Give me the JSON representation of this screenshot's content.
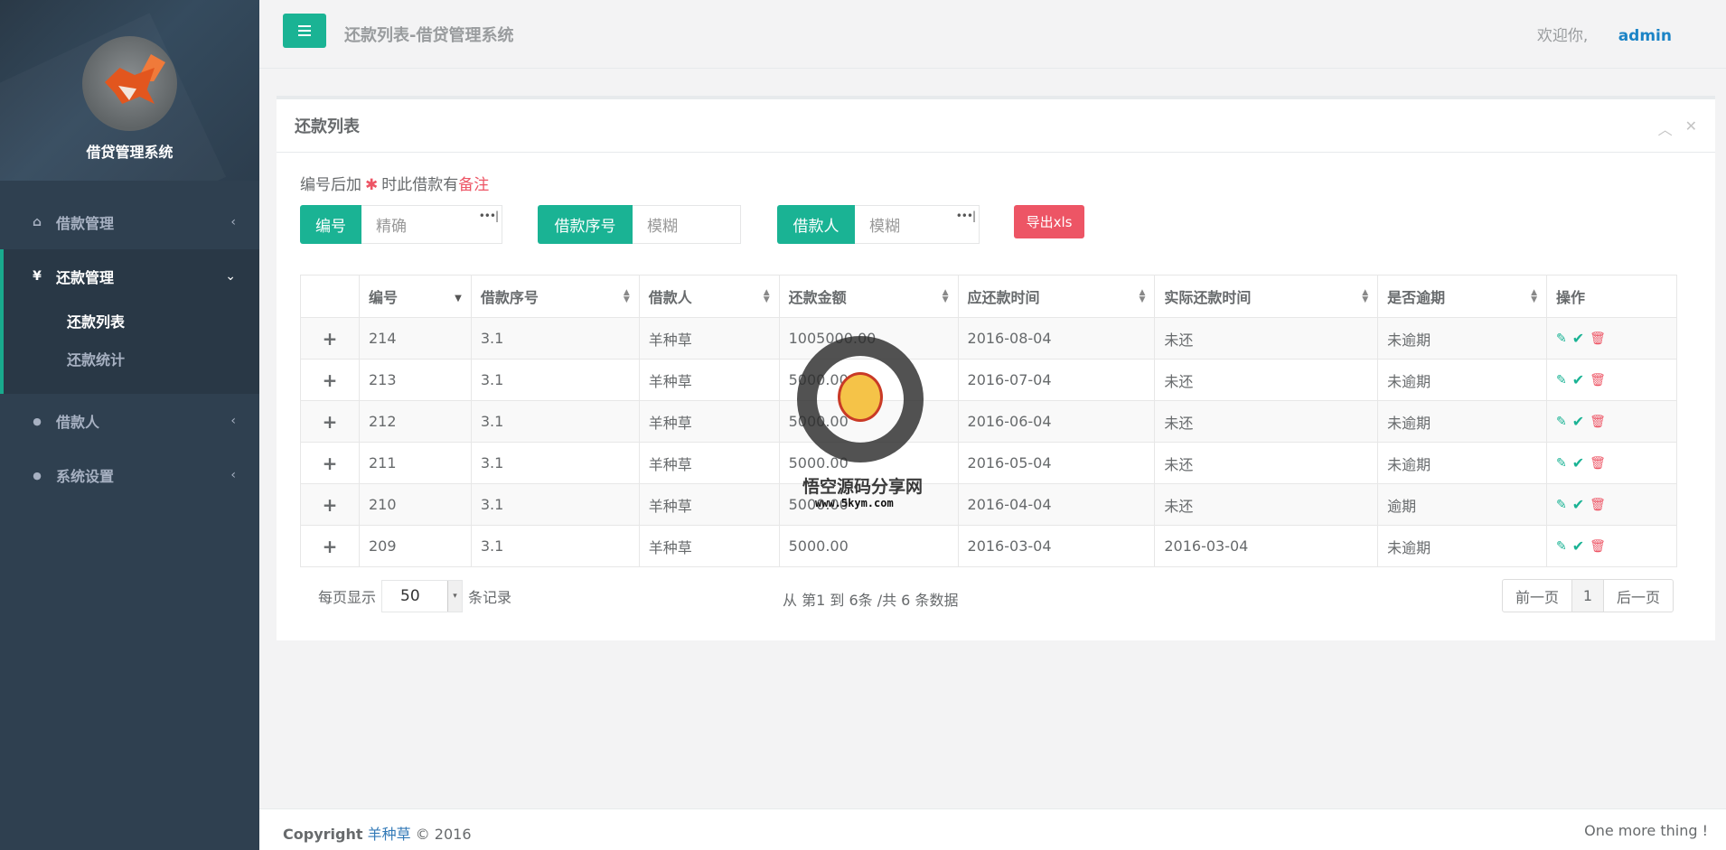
{
  "sidebar": {
    "brand": "借贷管理系统",
    "items": [
      {
        "label": "借款管理",
        "icon": "home-icon",
        "arrow": "‹"
      },
      {
        "label": "还款管理",
        "icon": "yen-icon",
        "arrow": "⌄",
        "children": [
          "还款列表",
          "还款统计"
        ]
      },
      {
        "label": "借款人",
        "icon": "user-icon",
        "arrow": "‹"
      },
      {
        "label": "系统设置",
        "icon": "user-icon",
        "arrow": "‹"
      }
    ],
    "icon_glyphs": {
      "home": "⌂",
      "yen": "¥",
      "user": "●"
    }
  },
  "topbar": {
    "title": "还款列表-借贷管理系统",
    "welcome": "欢迎你,",
    "user": "admin"
  },
  "panel": {
    "title": "还款列表",
    "note_prefix": "编号后加",
    "note_star": "✱",
    "note_mid": "时此借款有",
    "note_red": "备注"
  },
  "search": {
    "id_label": "编号",
    "id_placeholder": "精确",
    "seq_label": "借款序号",
    "seq_placeholder": "模糊",
    "borrower_label": "借款人",
    "borrower_placeholder": "模糊",
    "dots": "•••|",
    "export_label": "导出xls"
  },
  "table": {
    "headers": [
      "编号",
      "借款序号",
      "借款人",
      "还款金额",
      "应还款时间",
      "实际还款时间",
      "是否逾期",
      "操作"
    ],
    "rows": [
      {
        "id": "214",
        "seq": "3.1",
        "borrower": "羊种草",
        "amount": "1005000.00",
        "due": "2016-08-04",
        "actual": "未还",
        "overdue": "未逾期"
      },
      {
        "id": "213",
        "seq": "3.1",
        "borrower": "羊种草",
        "amount": "5000.00",
        "due": "2016-07-04",
        "actual": "未还",
        "overdue": "未逾期"
      },
      {
        "id": "212",
        "seq": "3.1",
        "borrower": "羊种草",
        "amount": "5000.00",
        "due": "2016-06-04",
        "actual": "未还",
        "overdue": "未逾期"
      },
      {
        "id": "211",
        "seq": "3.1",
        "borrower": "羊种草",
        "amount": "5000.00",
        "due": "2016-05-04",
        "actual": "未还",
        "overdue": "未逾期"
      },
      {
        "id": "210",
        "seq": "3.1",
        "borrower": "羊种草",
        "amount": "5000.00",
        "due": "2016-04-04",
        "actual": "未还",
        "overdue": "逾期"
      },
      {
        "id": "209",
        "seq": "3.1",
        "borrower": "羊种草",
        "amount": "5000.00",
        "due": "2016-03-04",
        "actual": "2016-03-04",
        "overdue": "未逾期"
      }
    ]
  },
  "pagination": {
    "per_page_prefix": "每页显示",
    "per_page_value": "50",
    "per_page_suffix": "条记录",
    "info": "从 第1 到 6条 /共 6 条数据",
    "prev": "前一页",
    "current": "1",
    "next": "后一页"
  },
  "watermark": {
    "text": "悟空源码分享网",
    "url": "www.5kym.com"
  },
  "footer": {
    "copyright": "Copyright",
    "author": "羊种草",
    "year": "© 2016",
    "right": "One more thing !"
  },
  "colors": {
    "primary": "#1ab394",
    "danger": "#ed5565",
    "link": "#337ab7",
    "sidebar": "#2f4050"
  }
}
